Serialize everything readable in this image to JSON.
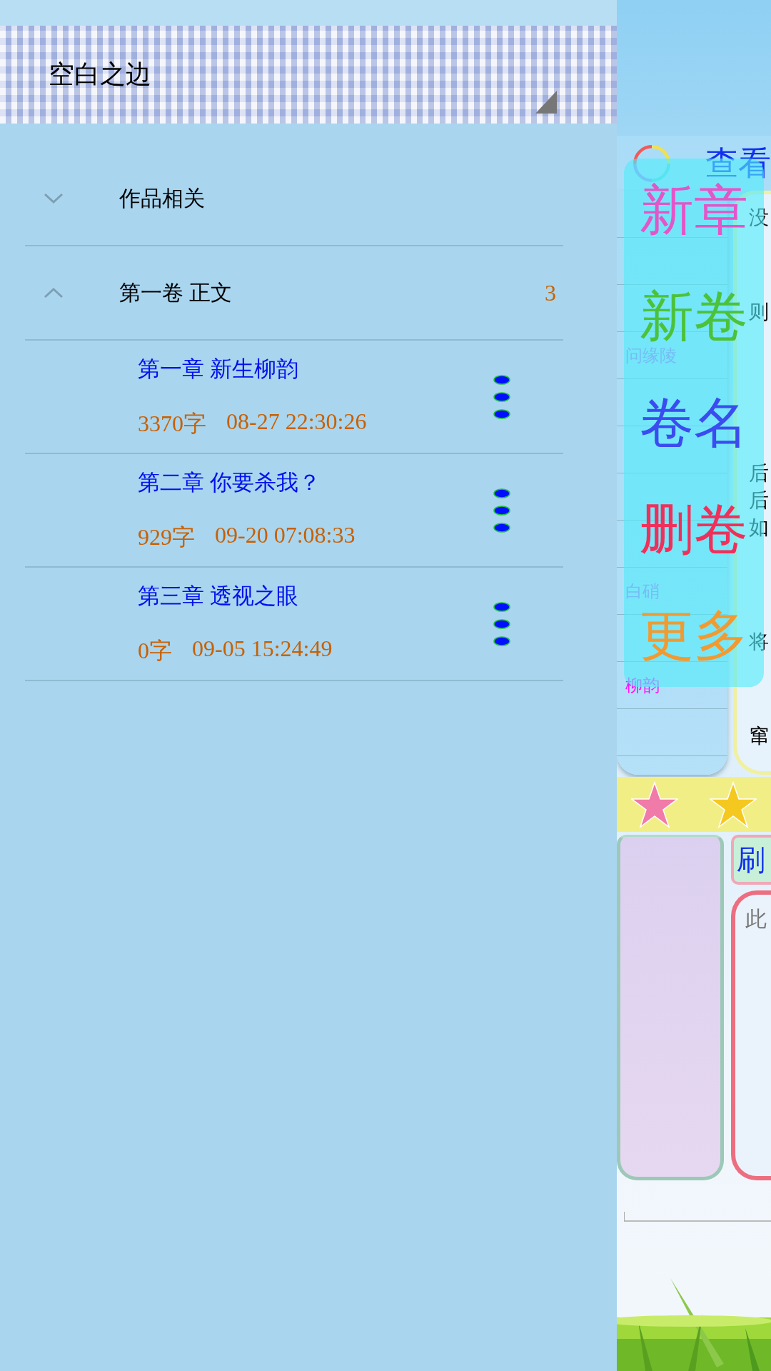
{
  "drawer": {
    "title": "空白之边",
    "groups": [
      {
        "name": "作品相关",
        "expanded": false
      },
      {
        "name": "第一卷 正文",
        "expanded": true,
        "count": "3",
        "chapters": [
          {
            "title": "第一章 新生柳韵",
            "words": "3370字",
            "time": "08-27 22:30:26"
          },
          {
            "title": "第二章 你要杀我？",
            "words": "929字",
            "time": "09-20 07:08:33"
          },
          {
            "title": "第三章 透视之眼",
            "words": "0字",
            "time": "09-05 15:24:49"
          }
        ]
      }
    ]
  },
  "app": {
    "view_button": "查看",
    "rows": [
      {
        "kind": "blank",
        "notes": [
          "没"
        ]
      },
      {
        "kind": "blank"
      },
      {
        "kind": "blank",
        "notes": [
          "则"
        ]
      },
      {
        "kind": "name",
        "name": "问缘陵"
      },
      {
        "kind": "blank"
      },
      {
        "kind": "blank"
      },
      {
        "kind": "blank",
        "notes": [
          "后",
          "后",
          "如"
        ]
      },
      {
        "kind": "blank"
      },
      {
        "kind": "name",
        "name": "白硝"
      },
      {
        "kind": "blank",
        "notes": [
          "将"
        ]
      },
      {
        "kind": "name",
        "name": "柳韵",
        "selected": true
      },
      {
        "kind": "blank",
        "notes": [
          "窜"
        ]
      }
    ],
    "menu": [
      {
        "label": "新章",
        "color": "#e455c8"
      },
      {
        "label": "新卷",
        "color": "#4cc23a"
      },
      {
        "label": "卷名",
        "color": "#3a4cf0"
      },
      {
        "label": "删卷",
        "color": "#f0305a"
      },
      {
        "label": "更多",
        "color": "#f29a30"
      }
    ],
    "refresh_button": "刷",
    "editor": {
      "placeholder": "此"
    }
  }
}
